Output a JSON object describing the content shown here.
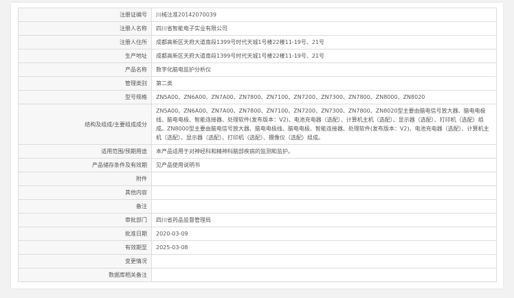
{
  "rows": [
    {
      "label": "注册证编号",
      "value": "川械注准20142070039"
    },
    {
      "label": "注册人名称",
      "value": "四川省智能电子实业有限公司"
    },
    {
      "label": "注册人住所",
      "value": "成都高新区天府大道南段1399号时代天城1号楼22楼11-19号、21号"
    },
    {
      "label": "生产地址",
      "value": "成都高新区天府大道南段1399号时代天城1号楼22楼11-19号、21号"
    },
    {
      "label": "产品名称",
      "value": "数字化脑电监护分析仪"
    },
    {
      "label": "管理类别",
      "value": "第二类"
    },
    {
      "label": "型号规格",
      "value": "ZN5A00、ZN6A00、ZN7A00、ZN7800、ZN7100、ZN7200、ZN7300、ZN7800、ZN8000、ZN8020"
    },
    {
      "label": "结构及组成/主要组成成分",
      "value": "ZN5A00、ZN6A00、ZN7A00、ZN7800、ZN7100、ZN7200、ZN7300、ZN7800、ZN8020型主要由脑电信号放大器、脑电电极线、脑电电极、智能连接器、处理软件(发布版本：V2)、电池充电器（选配）、计算机主机（选配）、显示器（选配）、打印机（选配）组成。ZN8000型主要由脑电信号放大器、脑电电极线、脑电电极、智能连接器、处理软件(发布版本：V2)、电池充电器（选配）、计算机主机（选配）、显示器（选配）、打印机（选配）、摄像仪（选配）组成。"
    },
    {
      "label": "适用范围/预期用途",
      "value": "本产品适用于对神经科和精神科脑部疾病的监测和监护。"
    },
    {
      "label": "产品储存条件及有效期",
      "value": "见产品使用说明书"
    },
    {
      "label": "附件",
      "value": ""
    },
    {
      "label": "其他内容",
      "value": ""
    },
    {
      "label": "备注",
      "value": ""
    },
    {
      "label": "审批部门",
      "value": "四川省药品监督管理局"
    },
    {
      "label": "批准日期",
      "value": "2020-03-09"
    },
    {
      "label": "有效期至",
      "value": "2025-03-08"
    },
    {
      "label": "变更情况",
      "value": ""
    },
    {
      "label": "数据库相关备注",
      "value": ""
    }
  ]
}
